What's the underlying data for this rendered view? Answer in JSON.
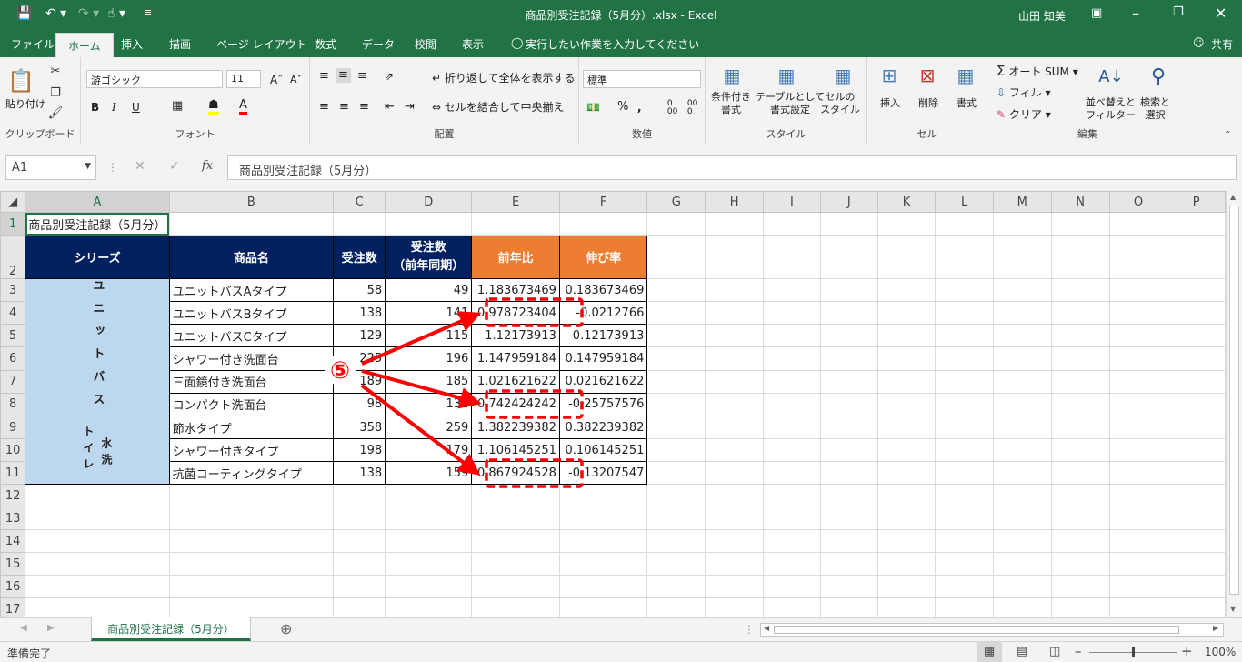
{
  "window": {
    "title": "商品別受注記録（5月分）.xlsx - Excel",
    "user": "山田 知美"
  },
  "tabs": [
    "ファイル",
    "ホーム",
    "挿入",
    "描画",
    "ページ レイアウト",
    "数式",
    "データ",
    "校閲",
    "表示"
  ],
  "tell_me": "実行したい作業を入力してください",
  "share": "共有",
  "ribbon": {
    "clipboard": {
      "paste": "貼り付け",
      "label": "クリップボード"
    },
    "font": {
      "name": "游ゴシック",
      "size": "11",
      "label": "フォント",
      "b": "B",
      "i": "I",
      "u": "U"
    },
    "align": {
      "wrap": "折り返して全体を表示する",
      "merge": "セルを結合して中央揃え",
      "label": "配置"
    },
    "number": {
      "format": "標準",
      "label": "数値"
    },
    "styles": {
      "cond": [
        "条件付き",
        "書式"
      ],
      "table": [
        "テーブルとして",
        "書式設定"
      ],
      "cell": [
        "セルの",
        "スタイル"
      ],
      "label": "スタイル"
    },
    "cells": {
      "insert": "挿入",
      "delete": "削除",
      "format": "書式",
      "label": "セル"
    },
    "edit": {
      "autosum": "オート SUM",
      "fill": "フィル",
      "clear": "クリア",
      "sort": [
        "並べ替えと",
        "フィルター"
      ],
      "find": [
        "検索と",
        "選択"
      ],
      "label": "編集"
    }
  },
  "namebox": "A1",
  "formula": "商品別受注記録（5月分）",
  "columns": [
    "A",
    "B",
    "C",
    "D",
    "E",
    "F",
    "G",
    "H",
    "I",
    "J",
    "K",
    "L",
    "M",
    "N",
    "O",
    "P"
  ],
  "sheet": {
    "title": "商品別受注記録（5月分）",
    "headers": {
      "series": "シリーズ",
      "product": "商品名",
      "orders": "受注数",
      "orders_prev_1": "受注数",
      "orders_prev_2": "（前年同期）",
      "yoy": "前年比",
      "growth": "伸び率"
    },
    "group1": "ユニットバス",
    "group2a": "トイレ",
    "group2b": "水洗",
    "rows": [
      {
        "name": "ユニットバスAタイプ",
        "c": "58",
        "d": "49",
        "e": "1.183673469",
        "f": "0.183673469"
      },
      {
        "name": "ユニットバスBタイプ",
        "c": "138",
        "d": "141",
        "e": "0.978723404",
        "f": "-0.0212766"
      },
      {
        "name": "ユニットバスCタイプ",
        "c": "129",
        "d": "115",
        "e": "1.12173913",
        "f": "0.12173913"
      },
      {
        "name": "シャワー付き洗面台",
        "c": "225",
        "d": "196",
        "e": "1.147959184",
        "f": "0.147959184"
      },
      {
        "name": "三面鏡付き洗面台",
        "c": "189",
        "d": "185",
        "e": "1.021621622",
        "f": "0.021621622"
      },
      {
        "name": "コンパクト洗面台",
        "c": "98",
        "d": "132",
        "e": "0.742424242",
        "f": "-0.25757576"
      },
      {
        "name": "節水タイプ",
        "c": "358",
        "d": "259",
        "e": "1.382239382",
        "f": "0.382239382"
      },
      {
        "name": "シャワー付きタイプ",
        "c": "198",
        "d": "179",
        "e": "1.106145251",
        "f": "0.106145251"
      },
      {
        "name": "抗菌コーティングタイプ",
        "c": "138",
        "d": "159",
        "e": "0.867924528",
        "f": "-0.13207547"
      }
    ]
  },
  "annotation": "⑤",
  "sheet_tab": "商品別受注記録（5月分）",
  "status": {
    "ready": "準備完了",
    "zoom": "100%"
  }
}
